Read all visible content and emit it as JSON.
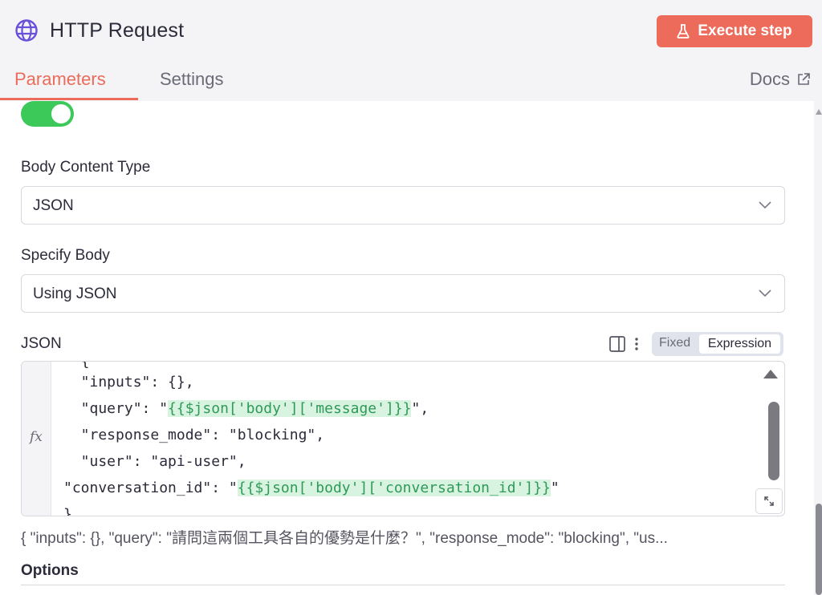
{
  "header": {
    "title": "HTTP Request",
    "execute_label": "Execute step",
    "icon": "globe-icon",
    "accent": "#ec6b5a"
  },
  "tabs": [
    {
      "label": "Parameters",
      "active": true
    },
    {
      "label": "Settings",
      "active": false
    }
  ],
  "docs_label": "Docs",
  "toggle": {
    "on": true,
    "color": "#3dc95a"
  },
  "body_content_type": {
    "label": "Body Content Type",
    "value": "JSON"
  },
  "specify_body": {
    "label": "Specify Body",
    "value": "Using JSON"
  },
  "json_field": {
    "label": "JSON",
    "mode_fixed": "Fixed",
    "mode_expression": "Expression",
    "active_mode": "Expression",
    "gutter_label": "fx",
    "lines": [
      {
        "pre": "  {",
        "expr": "",
        "post": ""
      },
      {
        "pre": "  \"inputs\": {},",
        "expr": "",
        "post": ""
      },
      {
        "pre": "  \"query\": \"",
        "expr": "{{$json['body']['message']}}",
        "post": "\","
      },
      {
        "pre": "  \"response_mode\": \"blocking\",",
        "expr": "",
        "post": ""
      },
      {
        "pre": "  \"user\": \"api-user\",",
        "expr": "",
        "post": ""
      },
      {
        "pre": "\"conversation_id\": \"",
        "expr": "{{$json['body']['conversation_id']}}",
        "post": "\""
      },
      {
        "pre": "}",
        "expr": "",
        "post": ""
      }
    ],
    "preview": "{   \"inputs\": {},   \"query\": \"請問這兩個工具各自的優勢是什麼？\",    \"response_mode\": \"blocking\",    \"us..."
  },
  "options_label": "Options"
}
